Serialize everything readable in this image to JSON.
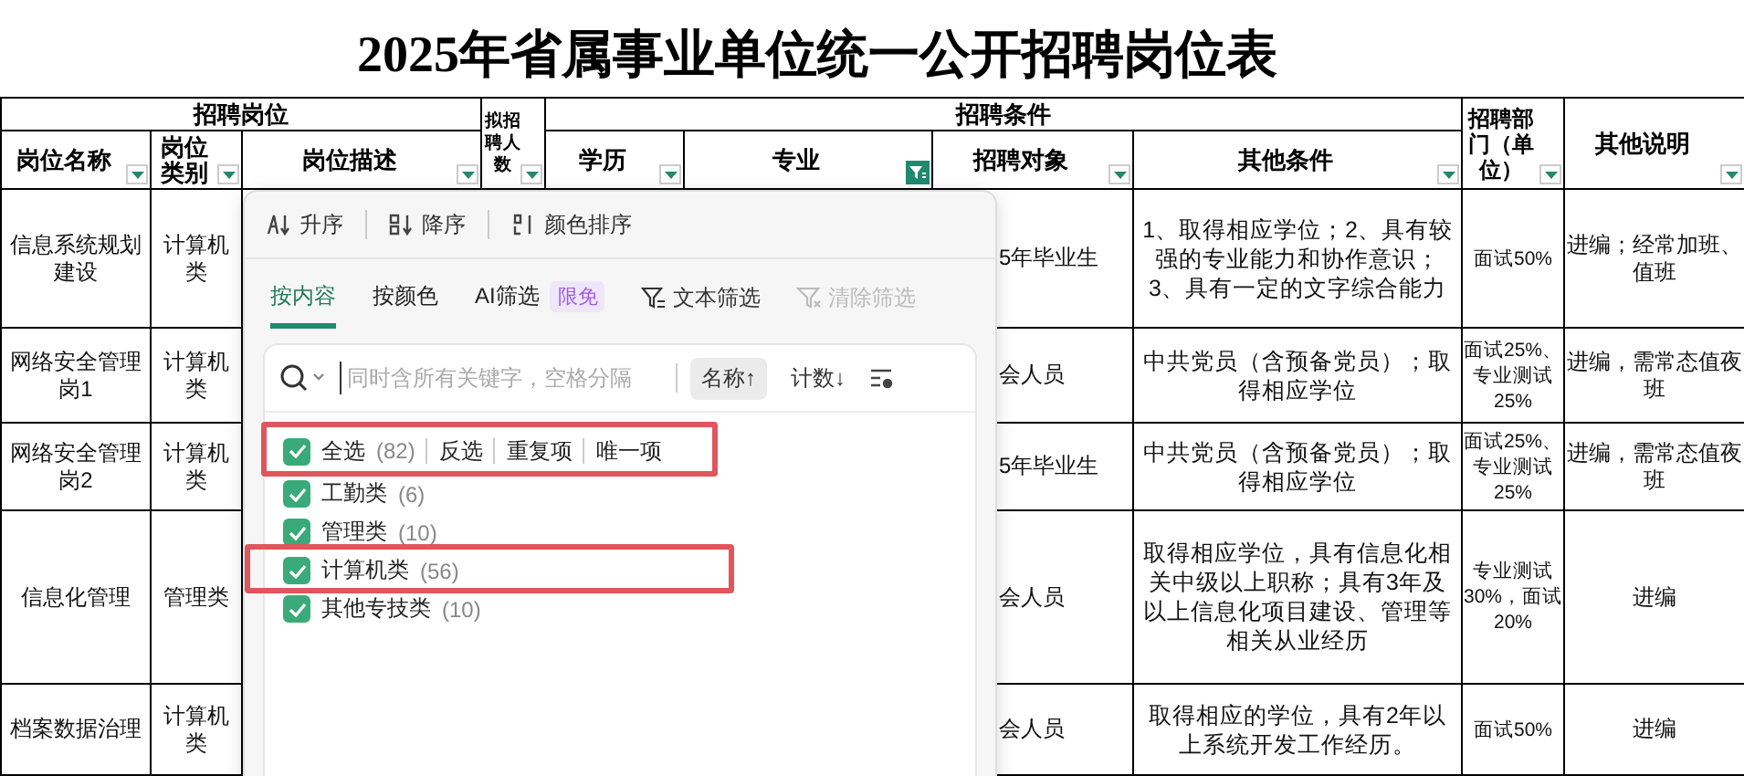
{
  "title": "2025年省属事业单位统一公开招聘岗位表",
  "header_groups": [
    "招聘岗位",
    "招聘条件"
  ],
  "columns": [
    {
      "label": "岗位名称",
      "filter_active": false
    },
    {
      "label": "岗位类别",
      "filter_active": false
    },
    {
      "label": "岗位描述",
      "filter_active": false
    },
    {
      "label": "拟招聘人数",
      "filter_active": false
    },
    {
      "label": "学历",
      "filter_active": false
    },
    {
      "label": "专业",
      "filter_active": true
    },
    {
      "label": "招聘对象",
      "filter_active": false
    },
    {
      "label": "其他条件",
      "filter_active": false
    },
    {
      "label": "招聘部门（单位）",
      "filter_active": false
    },
    {
      "label": "其他说明",
      "filter_active": false
    }
  ],
  "rows": [
    {
      "name": "信息系统规划建设",
      "category": "计算机类",
      "target": "5年毕业生",
      "conditions": "1、取得相应学位；2、具有较强的专业能力和协作意识；3、具有一定的文字综合能力",
      "assessment": "面试50%",
      "notes": "进编；经常加班、值班"
    },
    {
      "name": "网络安全管理岗1",
      "category": "计算机类",
      "target": "会人员",
      "conditions": "中共党员（含预备党员）；取得相应学位",
      "assessment": "面试25%、专业测试25%",
      "notes": "进编，需常态值夜班"
    },
    {
      "name": "网络安全管理岗2",
      "category": "计算机类",
      "target": "5年毕业生",
      "conditions": "中共党员（含预备党员）；取得相应学位",
      "assessment": "面试25%、专业测试25%",
      "notes": "进编，需常态值夜班"
    },
    {
      "name": "信息化管理",
      "category": "管理类",
      "target": "会人员",
      "conditions": "取得相应学位，具有信息化相关中级以上职称；具有3年及以上信息化项目建设、管理等相关从业经历",
      "assessment": "专业测试30%，面试20%",
      "notes": "进编"
    },
    {
      "name": "档案数据治理",
      "category": "计算机类",
      "target": "会人员",
      "conditions": "取得相应的学位，具有2年以上系统开发工作经历。",
      "assessment": "面试50%",
      "notes": "进编"
    }
  ],
  "filter_popup": {
    "sort_buttons": [
      {
        "label": "升序",
        "kind": "asc"
      },
      {
        "label": "降序",
        "kind": "desc"
      },
      {
        "label": "颜色排序",
        "kind": "color"
      }
    ],
    "tabs": [
      {
        "label": "按内容",
        "selected": true
      },
      {
        "label": "按颜色",
        "selected": false
      },
      {
        "label": "AI筛选",
        "selected": false,
        "badge": "限免"
      }
    ],
    "text_filter": {
      "label": "文本筛选",
      "disabled": false
    },
    "clear_filter": {
      "label": "清除筛选",
      "disabled": true
    },
    "search": {
      "placeholder": "同时含所有关键字，空格分隔"
    },
    "sort_chips": [
      {
        "label": "名称↑",
        "selected": true
      },
      {
        "label": "计数↓",
        "selected": false
      }
    ],
    "select_all": {
      "label": "全选",
      "count": "(82)",
      "checked": true,
      "highlighted": true
    },
    "actions": [
      "反选",
      "重复项",
      "唯一项"
    ],
    "items": [
      {
        "label": "工勤类",
        "count": "(6)",
        "checked": true,
        "highlighted": false
      },
      {
        "label": "管理类",
        "count": "(10)",
        "checked": true,
        "highlighted": false
      },
      {
        "label": "计算机类",
        "count": "(56)",
        "checked": true,
        "highlighted": true
      },
      {
        "label": "其他专技类",
        "count": "(10)",
        "checked": true,
        "highlighted": false
      }
    ]
  }
}
